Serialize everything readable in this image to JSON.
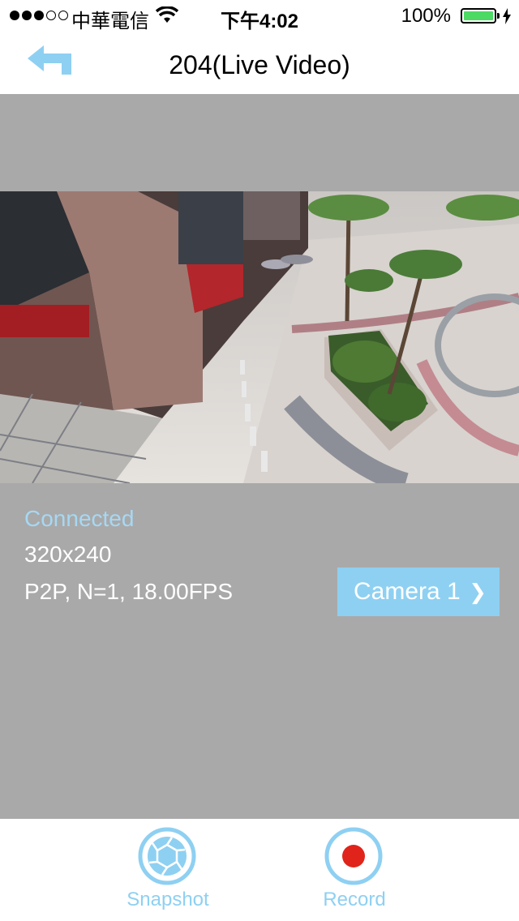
{
  "status_bar": {
    "carrier": "中華電信",
    "time": "下午4:02",
    "battery_percent": "100%",
    "signal_bars": 3,
    "signal_total": 5,
    "battery_level": 1.0,
    "icons": [
      "wifi-icon",
      "battery-icon",
      "charging-bolt-icon"
    ]
  },
  "nav": {
    "title": "204(Live Video)",
    "back_icon": "back-arrow-icon"
  },
  "info": {
    "status": "Connected",
    "resolution": "320x240",
    "stream": "P2P, N=1, 18.00FPS"
  },
  "camera_selector": {
    "label": "Camera 1",
    "chevron": "❯"
  },
  "tabs": [
    {
      "label": "Snapshot",
      "icon": "camera-shutter-icon"
    },
    {
      "label": "Record",
      "icon": "record-icon"
    }
  ],
  "colors": {
    "accent": "#8ed0f2",
    "status_text": "#a6d8f3",
    "background": "#a9a9a9",
    "record_dot": "#e0241b",
    "battery": "#4cd964"
  }
}
